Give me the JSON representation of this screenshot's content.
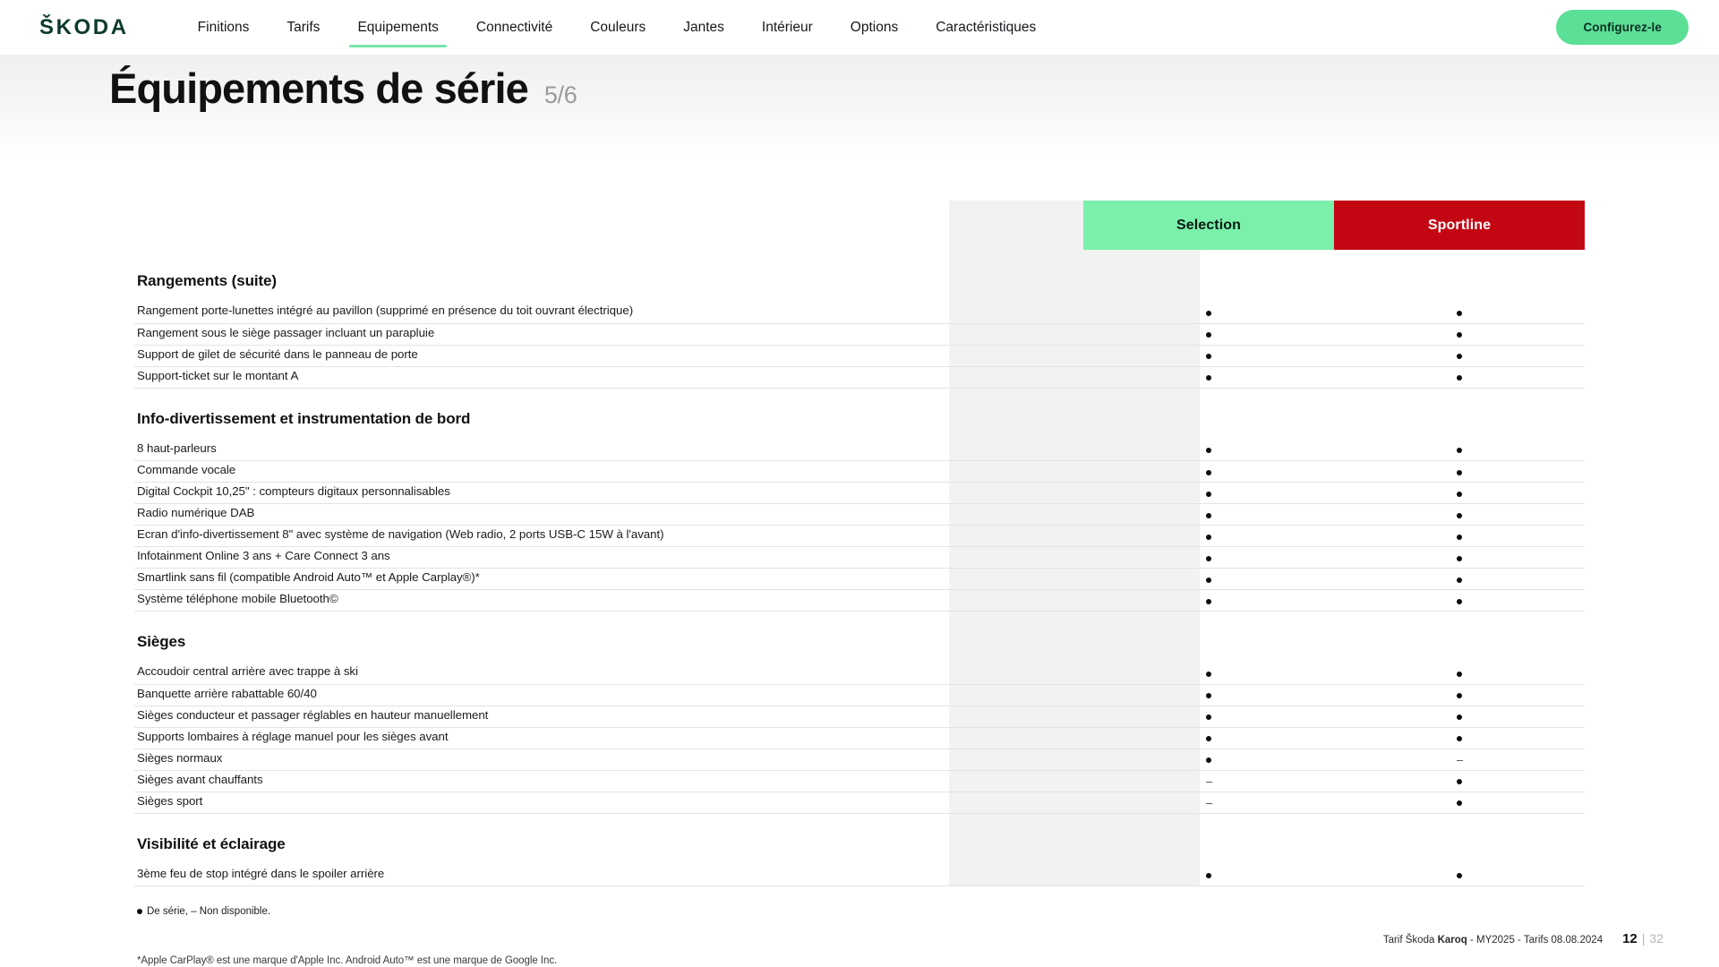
{
  "header": {
    "brand": "ŠKODA",
    "nav": [
      {
        "label": "Finitions",
        "active": false
      },
      {
        "label": "Tarifs",
        "active": false
      },
      {
        "label": "Equipements",
        "active": true
      },
      {
        "label": "Connectivité",
        "active": false
      },
      {
        "label": "Couleurs",
        "active": false
      },
      {
        "label": "Jantes",
        "active": false
      },
      {
        "label": "Intérieur",
        "active": false
      },
      {
        "label": "Options",
        "active": false
      },
      {
        "label": "Caractéristiques",
        "active": false
      }
    ],
    "cta_label": "Configurez-le",
    "accent_green": "#5cdf96"
  },
  "page": {
    "title": "Équipements de série",
    "counter": "5/6"
  },
  "table": {
    "columns": [
      {
        "label": "Selection",
        "bg": "#7af0ab",
        "fg": "#0b1a12"
      },
      {
        "label": "Sportline",
        "bg": "#c30712",
        "fg": "#ffffff"
      }
    ],
    "sections": [
      {
        "title": "Rangements (suite)",
        "rows": [
          {
            "label": "Rangement porte-lunettes intégré au pavillon (supprimé en présence du toit ouvrant électrique)",
            "selection": "dot",
            "sportline": "dot"
          },
          {
            "label": "Rangement sous le siège passager incluant un parapluie",
            "selection": "dot",
            "sportline": "dot"
          },
          {
            "label": "Support de gilet de sécurité dans le panneau de porte",
            "selection": "dot",
            "sportline": "dot"
          },
          {
            "label": "Support-ticket sur le montant A",
            "selection": "dot",
            "sportline": "dot"
          }
        ]
      },
      {
        "title": "Info-divertissement et instrumentation de bord",
        "rows": [
          {
            "label": "8 haut-parleurs",
            "selection": "dot",
            "sportline": "dot"
          },
          {
            "label": "Commande vocale",
            "selection": "dot",
            "sportline": "dot"
          },
          {
            "label": "Digital Cockpit 10,25\" : compteurs digitaux personnalisables",
            "selection": "dot",
            "sportline": "dot"
          },
          {
            "label": "Radio numérique DAB",
            "selection": "dot",
            "sportline": "dot"
          },
          {
            "label": "Ecran d'info-divertissement 8\" avec système de navigation (Web radio, 2 ports USB-C 15W à l'avant)",
            "selection": "dot",
            "sportline": "dot"
          },
          {
            "label": "Infotainment Online 3 ans + Care Connect 3 ans",
            "selection": "dot",
            "sportline": "dot"
          },
          {
            "label": "Smartlink sans fil (compatible Android Auto™ et Apple Carplay®)*",
            "selection": "dot",
            "sportline": "dot"
          },
          {
            "label": "Système téléphone mobile Bluetooth©",
            "selection": "dot",
            "sportline": "dot"
          }
        ]
      },
      {
        "title": "Sièges",
        "rows": [
          {
            "label": "Accoudoir central arrière avec trappe à ski",
            "selection": "dot",
            "sportline": "dot"
          },
          {
            "label": "Banquette arrière rabattable 60/40",
            "selection": "dot",
            "sportline": "dot"
          },
          {
            "label": "Sièges conducteur et passager réglables en hauteur manuellement",
            "selection": "dot",
            "sportline": "dot"
          },
          {
            "label": "Supports lombaires à réglage manuel pour les sièges avant",
            "selection": "dot",
            "sportline": "dot"
          },
          {
            "label": "Sièges normaux",
            "selection": "dot",
            "sportline": "dash"
          },
          {
            "label": "Sièges avant chauffants",
            "selection": "dash",
            "sportline": "dot"
          },
          {
            "label": "Sièges sport",
            "selection": "dash",
            "sportline": "dot"
          }
        ]
      },
      {
        "title": "Visibilité et éclairage",
        "rows": [
          {
            "label": "3ème feu de stop intégré dans le spoiler arrière",
            "selection": "dot",
            "sportline": "dot"
          }
        ]
      }
    ],
    "legend": "De série,  – Non disponible.",
    "footnote": "*Apple CarPlay® est une marque d'Apple Inc. Android Auto™ est une marque de Google Inc."
  },
  "footer": {
    "text_prefix": "Tarif Škoda ",
    "text_bold": "Karoq",
    "text_suffix": " - MY2025 - Tarifs 08.08.2024",
    "page_current": "12",
    "page_separator": "|",
    "page_total": "32"
  }
}
